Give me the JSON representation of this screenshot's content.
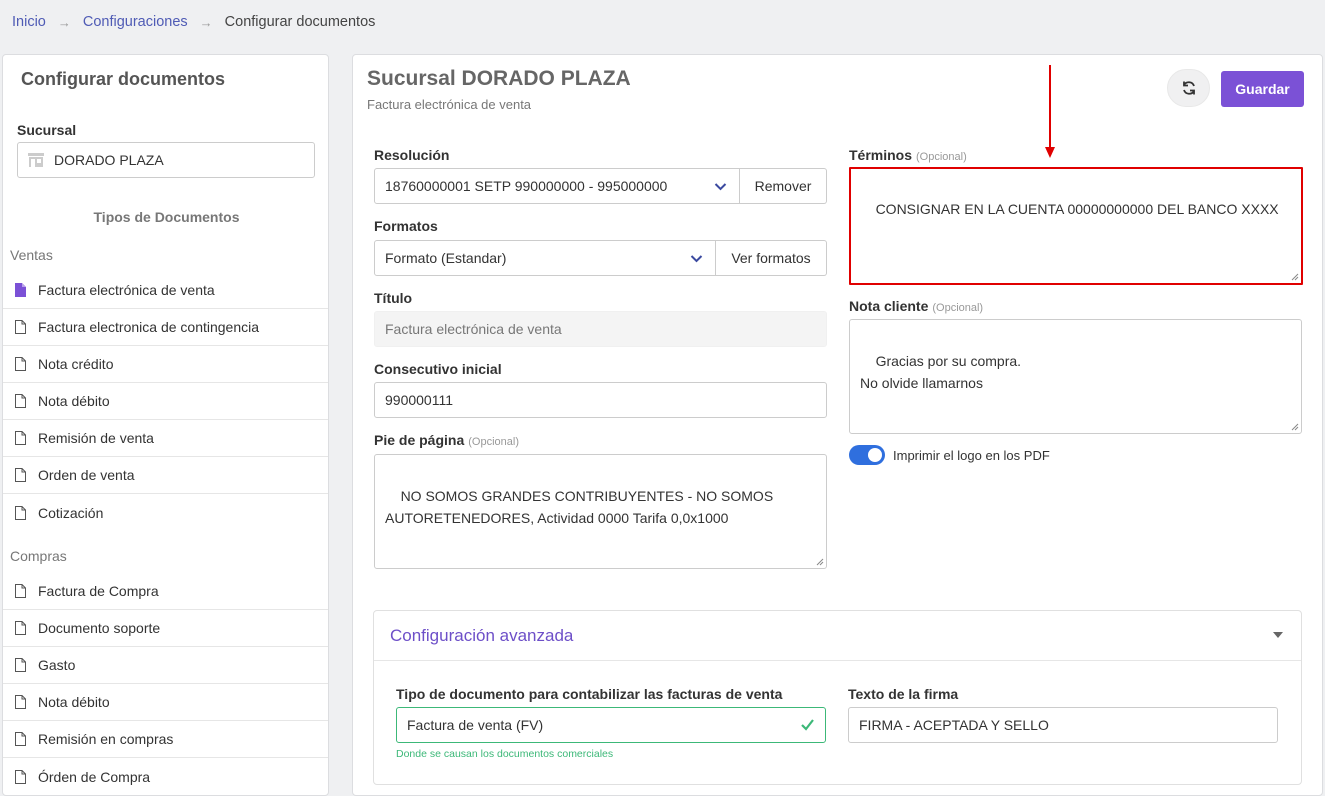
{
  "breadcrumb": {
    "home": "Inicio",
    "settings": "Configuraciones",
    "current": "Configurar documentos"
  },
  "sidebar": {
    "title": "Configurar documentos",
    "branch_label": "Sucursal",
    "branch_value": "DORADO PLAZA",
    "types_title": "Tipos de Documentos",
    "groups": [
      {
        "label": "Ventas",
        "items": [
          "Factura electrónica de venta",
          "Factura electronica de contingencia",
          "Nota crédito",
          "Nota débito",
          "Remisión de venta",
          "Orden de venta",
          "Cotización"
        ]
      },
      {
        "label": "Compras",
        "items": [
          "Factura de Compra",
          "Documento soporte",
          "Gasto",
          "Nota débito",
          "Remisión en compras",
          "Órden de Compra"
        ]
      }
    ]
  },
  "main": {
    "title": "Sucursal DORADO PLAZA",
    "subtitle": "Factura electrónica de venta",
    "save_label": "Guardar",
    "resolution": {
      "label": "Resolución",
      "value": "18760000001 SETP 990000000 - 995000000",
      "action": "Remover"
    },
    "formats": {
      "label": "Formatos",
      "value": "Formato (Estandar)",
      "action": "Ver formatos"
    },
    "doc_title": {
      "label": "Título",
      "value": "Factura electrónica de venta"
    },
    "initial_seq": {
      "label": "Consecutivo inicial",
      "value": "990000111"
    },
    "footer": {
      "label": "Pie de página",
      "optional": "(Opcional)",
      "value": "NO SOMOS GRANDES CONTRIBUYENTES - NO SOMOS\nAUTORETENEDORES, Actividad 0000 Tarifa 0,0x1000"
    },
    "terms": {
      "label": "Términos",
      "optional": "(Opcional)",
      "value": "CONSIGNAR EN LA CUENTA 00000000000 DEL BANCO XXXX"
    },
    "client_note": {
      "label": "Nota cliente",
      "optional": "(Opcional)",
      "value": "Gracias por su compra.\nNo olvide llamarnos"
    },
    "print_logo": {
      "label": "Imprimir el logo en los PDF",
      "checked": true
    },
    "advanced": {
      "title": "Configuración avanzada",
      "doc_type": {
        "label": "Tipo de documento para contabilizar las facturas de venta",
        "value": "Factura de venta (FV)",
        "help": "Donde se causan los documentos comerciales"
      },
      "signature": {
        "label": "Texto de la firma",
        "value": "FIRMA - ACEPTADA Y SELLO"
      }
    }
  },
  "colors": {
    "accent": "#7b51d6",
    "link": "#4f5bb5",
    "highlight": "#e00000",
    "success": "#3cb878",
    "toggle": "#2f6fde"
  }
}
